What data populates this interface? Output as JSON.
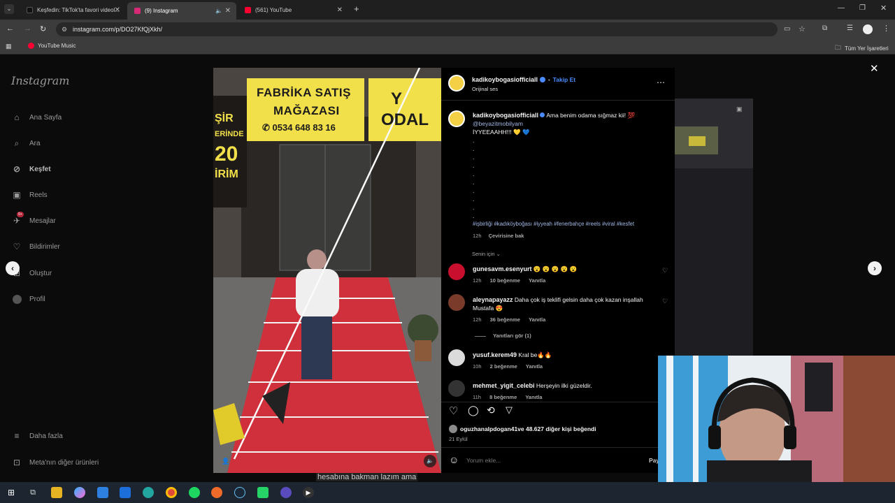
{
  "browser": {
    "tabs": [
      {
        "label": "Keşfedin: TikTok'ta favori videol..."
      },
      {
        "label": "(9) Instagram"
      },
      {
        "label": "(561) YouTube"
      }
    ],
    "url": "instagram.com/p/DO27KfQjXkh/",
    "bookmark": "YouTube Music",
    "all_bookmarks": "Tüm Yer İşaretleri"
  },
  "sidebar": {
    "logo": "Instagram",
    "items": [
      {
        "label": "Ana Sayfa",
        "icon": "home-icon"
      },
      {
        "label": "Ara",
        "icon": "search-icon"
      },
      {
        "label": "Keşfet",
        "icon": "compass-icon"
      },
      {
        "label": "Reels",
        "icon": "reels-icon"
      },
      {
        "label": "Mesajlar",
        "icon": "messenger-icon",
        "badge": "9+"
      },
      {
        "label": "Bildirimler",
        "icon": "heart-icon"
      },
      {
        "label": "Oluştur",
        "icon": "plus-icon"
      },
      {
        "label": "Profil",
        "icon": "avatar-icon"
      }
    ],
    "more": "Daha fazla",
    "meta": "Meta'nın diğer ürünleri"
  },
  "video": {
    "sign_line1": "FABRİKA SATIŞ",
    "sign_line2": "MAĞAZASI",
    "phone": "✆ 0534 648 83 16",
    "side_left": [
      "ŞİR",
      "ERİNDE",
      "20",
      "İRİM"
    ],
    "side_right": [
      "Y",
      "ODAL"
    ],
    "caption_under": "hesabına bakman lazım ama"
  },
  "post": {
    "author": "kadikoybogasiofficiall",
    "follow": "Takip Et",
    "audio": "Orijinal ses",
    "caption_text": "Ama benim odama sığmaz kii! 💯",
    "mention": "@beyazitmobilyam",
    "caption_line2": "İYYEEAAHH!!! 💛 💙",
    "hashtags": "#işbirliği #kadıköyboğası #iyyeah #fenerbahçe #reels #viral #kesfet",
    "time": "12h",
    "translate": "Çevirisine bak",
    "sort": "Senin için",
    "comments": [
      {
        "user": "gunesavm.esenyurt",
        "text": "😮 😮 😮 😮 😮",
        "time": "12h",
        "likes": "10 beğenme",
        "reply": "Yanıtla"
      },
      {
        "user": "aleynapayazz",
        "text": "Daha çok iş teklifi gelsin daha çok kazan inşallah Mustafa 😍",
        "time": "12h",
        "likes": "36 beğenme",
        "reply": "Yanıtla"
      },
      {
        "user": "yusuf.kerem49",
        "text": "Kral be🔥🔥",
        "time": "10h",
        "likes": "2 beğenme",
        "reply": "Yanıtla"
      },
      {
        "user": "mehmet_yigit_celebi",
        "text": "Herşeyin ilki güzeldir.",
        "time": "11h",
        "likes": "8 beğenme",
        "reply": "Yanıtla"
      }
    ],
    "view_replies": "Yanıtları gör (1)",
    "liked_by_user": "oguzhanalpdogan41",
    "liked_by_rest": " ve 48.627 diğer kişi beğendi",
    "date": "21 Eylül",
    "comment_placeholder": "Yorum ekle...",
    "post_btn": "Pay"
  },
  "colors": {
    "accent": "#4a8cff",
    "sign_yellow": "#f2e04a",
    "carpet_red": "#d0303c"
  }
}
